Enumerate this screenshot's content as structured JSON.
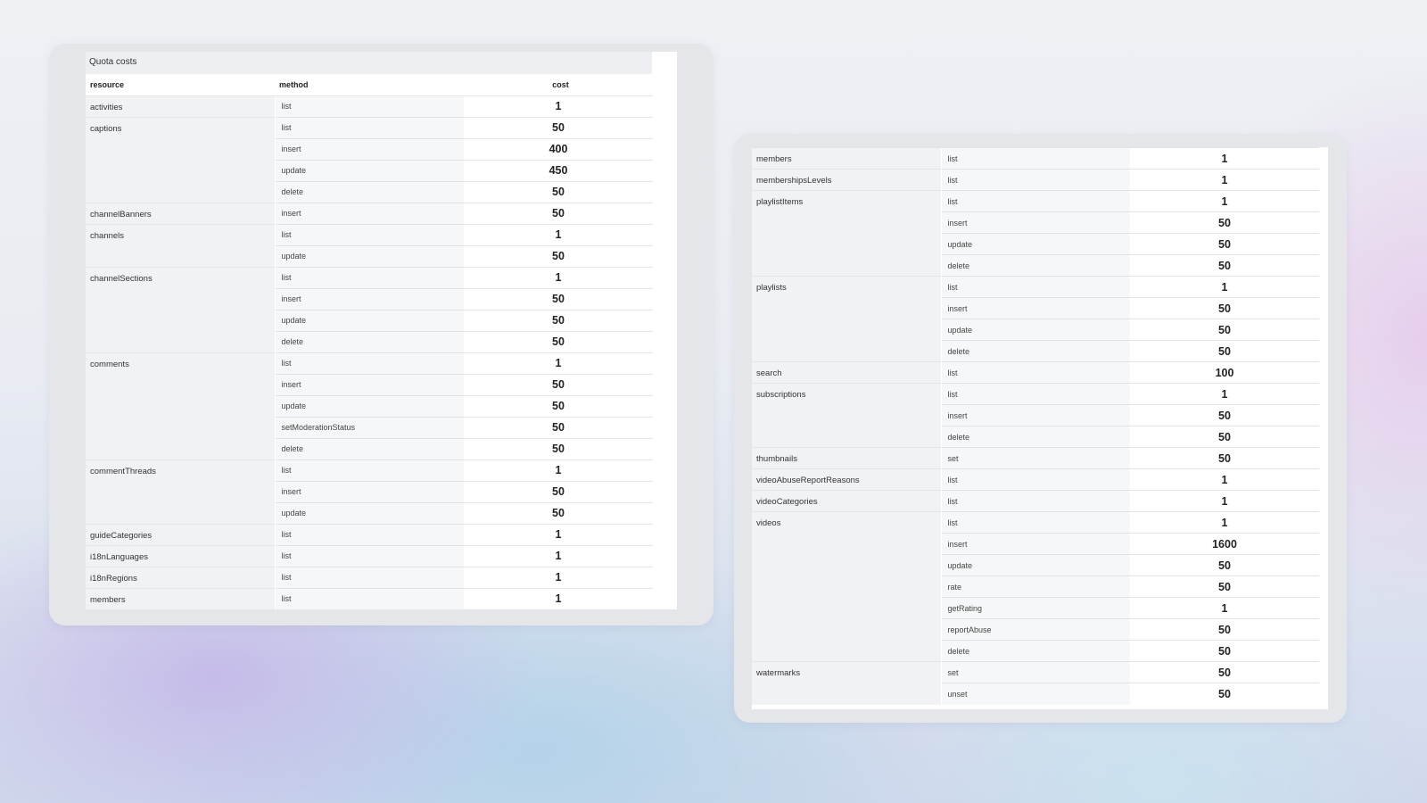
{
  "table": {
    "caption": "Quota costs",
    "headers": {
      "resource": "resource",
      "method": "method",
      "cost": "cost"
    }
  },
  "left_rows": [
    {
      "resource": "activities",
      "methods": [
        [
          "list",
          "1"
        ]
      ]
    },
    {
      "resource": "captions",
      "methods": [
        [
          "list",
          "50"
        ],
        [
          "insert",
          "400"
        ],
        [
          "update",
          "450"
        ],
        [
          "delete",
          "50"
        ]
      ]
    },
    {
      "resource": "channelBanners",
      "methods": [
        [
          "insert",
          "50"
        ]
      ]
    },
    {
      "resource": "channels",
      "methods": [
        [
          "list",
          "1"
        ],
        [
          "update",
          "50"
        ]
      ]
    },
    {
      "resource": "channelSections",
      "methods": [
        [
          "list",
          "1"
        ],
        [
          "insert",
          "50"
        ],
        [
          "update",
          "50"
        ],
        [
          "delete",
          "50"
        ]
      ]
    },
    {
      "resource": "comments",
      "methods": [
        [
          "list",
          "1"
        ],
        [
          "insert",
          "50"
        ],
        [
          "update",
          "50"
        ],
        [
          "setModerationStatus",
          "50"
        ],
        [
          "delete",
          "50"
        ]
      ]
    },
    {
      "resource": "commentThreads",
      "methods": [
        [
          "list",
          "1"
        ],
        [
          "insert",
          "50"
        ],
        [
          "update",
          "50"
        ]
      ]
    },
    {
      "resource": "guideCategories",
      "methods": [
        [
          "list",
          "1"
        ]
      ]
    },
    {
      "resource": "i18nLanguages",
      "methods": [
        [
          "list",
          "1"
        ]
      ]
    },
    {
      "resource": "i18nRegions",
      "methods": [
        [
          "list",
          "1"
        ]
      ]
    },
    {
      "resource": "members",
      "methods": [
        [
          "list",
          "1"
        ]
      ]
    }
  ],
  "right_rows": [
    {
      "resource": "members",
      "methods": [
        [
          "list",
          "1"
        ]
      ]
    },
    {
      "resource": "membershipsLevels",
      "methods": [
        [
          "list",
          "1"
        ]
      ]
    },
    {
      "resource": "playlistItems",
      "methods": [
        [
          "list",
          "1"
        ],
        [
          "insert",
          "50"
        ],
        [
          "update",
          "50"
        ],
        [
          "delete",
          "50"
        ]
      ]
    },
    {
      "resource": "playlists",
      "methods": [
        [
          "list",
          "1"
        ],
        [
          "insert",
          "50"
        ],
        [
          "update",
          "50"
        ],
        [
          "delete",
          "50"
        ]
      ]
    },
    {
      "resource": "search",
      "methods": [
        [
          "list",
          "100"
        ]
      ]
    },
    {
      "resource": "subscriptions",
      "methods": [
        [
          "list",
          "1"
        ],
        [
          "insert",
          "50"
        ],
        [
          "delete",
          "50"
        ]
      ]
    },
    {
      "resource": "thumbnails",
      "methods": [
        [
          "set",
          "50"
        ]
      ]
    },
    {
      "resource": "videoAbuseReportReasons",
      "methods": [
        [
          "list",
          "1"
        ]
      ]
    },
    {
      "resource": "videoCategories",
      "methods": [
        [
          "list",
          "1"
        ]
      ]
    },
    {
      "resource": "videos",
      "methods": [
        [
          "list",
          "1"
        ],
        [
          "insert",
          "1600"
        ],
        [
          "update",
          "50"
        ],
        [
          "rate",
          "50"
        ],
        [
          "getRating",
          "1"
        ],
        [
          "reportAbuse",
          "50"
        ],
        [
          "delete",
          "50"
        ]
      ]
    },
    {
      "resource": "watermarks",
      "methods": [
        [
          "set",
          "50"
        ],
        [
          "unset",
          "50"
        ]
      ]
    }
  ]
}
